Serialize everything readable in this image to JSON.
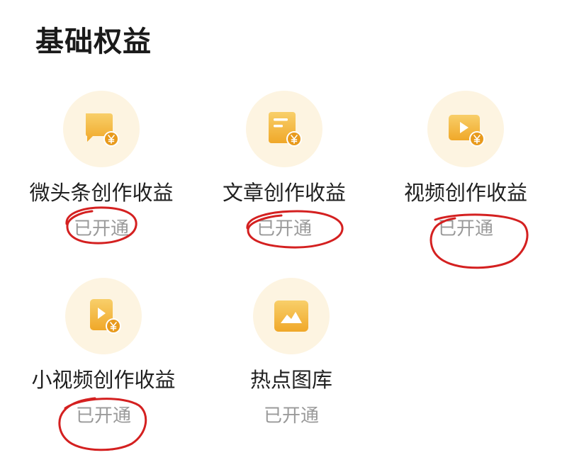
{
  "section": {
    "title": "基础权益"
  },
  "benefits": [
    {
      "label": "微头条创作收益",
      "status": "已开通",
      "icon": "chat-bubble-yuan-icon"
    },
    {
      "label": "文章创作收益",
      "status": "已开通",
      "icon": "document-yuan-icon"
    },
    {
      "label": "视频创作收益",
      "status": "已开通",
      "icon": "video-yuan-icon"
    },
    {
      "label": "小视频创作收益",
      "status": "已开通",
      "icon": "short-video-yuan-icon"
    },
    {
      "label": "热点图库",
      "status": "已开通",
      "icon": "image-gallery-icon"
    }
  ],
  "colors": {
    "icon_gradient_top": "#f8cf6a",
    "icon_gradient_bottom": "#f0a829",
    "icon_circle_bg": "#fdf4e1",
    "title_text": "#1a1a1a",
    "label_text": "#1f1f1f",
    "status_text": "#9a9a9a",
    "annotation_ring": "#d42020"
  }
}
